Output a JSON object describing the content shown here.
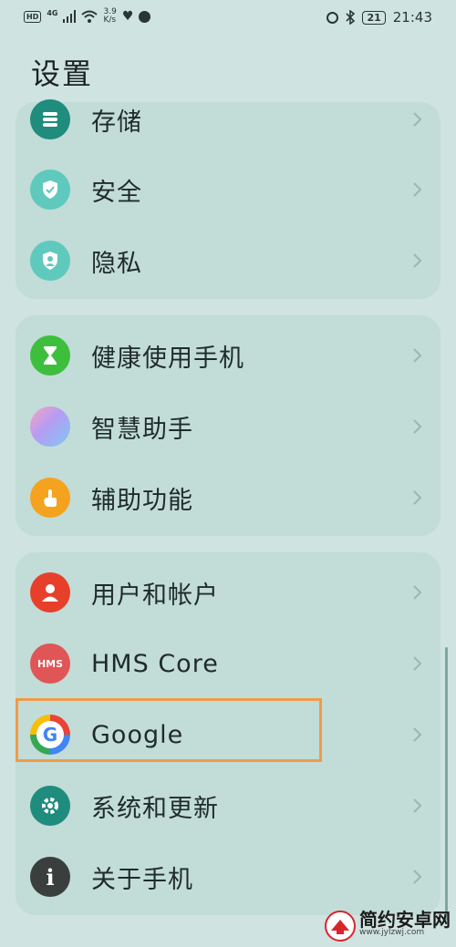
{
  "status_bar": {
    "hd": "HD",
    "network": "4G",
    "speed_value": "3.9",
    "speed_unit": "K/s",
    "battery": "21",
    "time": "21:43"
  },
  "page_title": "设置",
  "groups": [
    {
      "items": [
        {
          "label": "存储",
          "icon": "storage-icon",
          "color": "#1f8c7d"
        },
        {
          "label": "安全",
          "icon": "shield-icon",
          "color": "#5fc9bd"
        },
        {
          "label": "隐私",
          "icon": "privacy-icon",
          "color": "#5fc9bd"
        }
      ]
    },
    {
      "items": [
        {
          "label": "健康使用手机",
          "icon": "hourglass-icon",
          "color": "#3dbf3d"
        },
        {
          "label": "智慧助手",
          "icon": "assistant-icon",
          "color": "#b49cf2"
        },
        {
          "label": "辅助功能",
          "icon": "hand-icon",
          "color": "#f5a21f"
        }
      ]
    },
    {
      "items": [
        {
          "label": "用户和帐户",
          "icon": "user-icon",
          "color": "#e6402b"
        },
        {
          "label": "HMS Core",
          "icon": "hms-icon",
          "color": "#e05555",
          "icon_text": "HMS"
        },
        {
          "label": "Google",
          "icon": "google-icon",
          "color": "#ffffff",
          "icon_text": "G"
        },
        {
          "label": "系统和更新",
          "icon": "system-update-icon",
          "color": "#1f8c7d"
        },
        {
          "label": "关于手机",
          "icon": "info-icon",
          "color": "#3a3f3e",
          "icon_text": "i"
        }
      ]
    }
  ],
  "watermark": {
    "title": "简约安卓网",
    "url": "www.jylzwj.com"
  }
}
